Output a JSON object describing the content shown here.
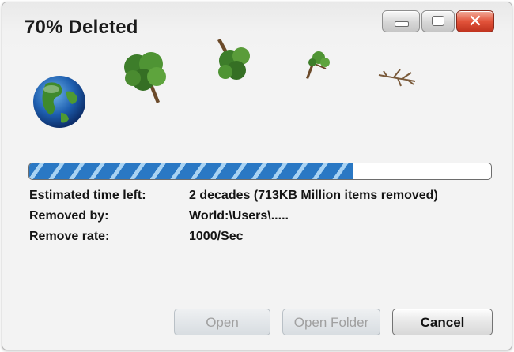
{
  "window": {
    "title": "70% Deleted",
    "controls": [
      {
        "name": "minimize",
        "icon": "minimize-icon"
      },
      {
        "name": "maximize",
        "icon": "maximize-icon"
      },
      {
        "name": "close",
        "icon": "close-icon",
        "glyph": "✕"
      }
    ]
  },
  "illustration": {
    "icons": [
      "globe-icon",
      "tree-full-icon",
      "tree-falling-icon",
      "tree-sparse-icon",
      "tree-dead-icon"
    ]
  },
  "progress": {
    "percent": 70,
    "fill_color": "#2a78c4",
    "stripe_color": "#a9d3f3"
  },
  "details": [
    {
      "label": "Estimated time left:",
      "value": "2 decades (713KB Million items removed)"
    },
    {
      "label": "Removed by:",
      "value": "World:\\Users\\....."
    },
    {
      "label": "Remove rate:",
      "value": "1000/Sec"
    }
  ],
  "buttons": {
    "open": "Open",
    "open_folder": "Open Folder",
    "cancel": "Cancel"
  },
  "colors": {
    "close_button": "#d9432c",
    "title_text": "#1c1c1c"
  }
}
